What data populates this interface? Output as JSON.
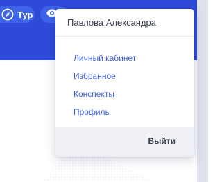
{
  "header": {
    "tour_label": "Тур",
    "tour_icon": "compass-icon",
    "eye_icon": "eye-icon"
  },
  "user_menu": {
    "user_name": "Павлова Александра",
    "items": [
      {
        "label": "Личный кабинет"
      },
      {
        "label": "Избранное"
      },
      {
        "label": "Конспекты"
      },
      {
        "label": "Профиль"
      }
    ],
    "logout_label": "Выйти"
  },
  "colors": {
    "header_bg": "#2f4ad8",
    "button_bg": "#3d64e7",
    "link": "#3e5ee0",
    "footer_bg": "#eef0f5"
  }
}
